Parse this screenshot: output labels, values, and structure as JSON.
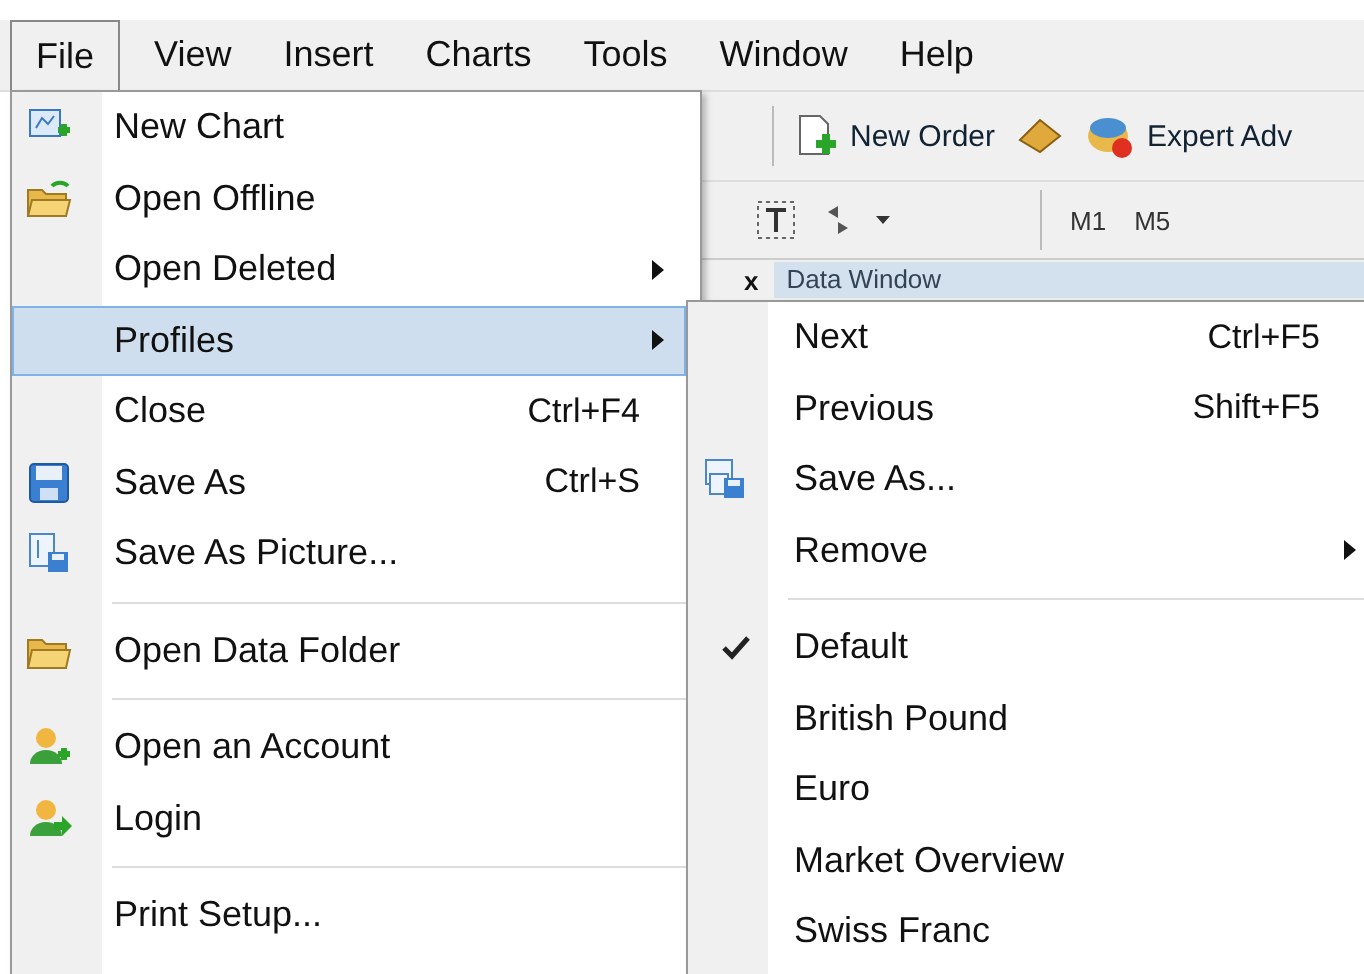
{
  "menubar": [
    {
      "label": "File",
      "selected": true
    },
    {
      "label": "View",
      "selected": false
    },
    {
      "label": "Insert",
      "selected": false
    },
    {
      "label": "Charts",
      "selected": false
    },
    {
      "label": "Tools",
      "selected": false
    },
    {
      "label": "Window",
      "selected": false
    },
    {
      "label": "Help",
      "selected": false
    }
  ],
  "toolbar": {
    "new_order": "New Order",
    "expert": "Expert Adv",
    "timeframes": [
      "M1",
      "M5"
    ],
    "close": "x",
    "panel_tab": "Data Window"
  },
  "file_menu": [
    {
      "kind": "item",
      "label": "New Chart",
      "selected": false,
      "submenu": false
    },
    {
      "kind": "item",
      "label": "Open Offline",
      "selected": false,
      "submenu": false
    },
    {
      "kind": "item",
      "label": "Open Deleted",
      "selected": false,
      "submenu": true
    },
    {
      "kind": "item",
      "label": "Profiles",
      "selected": true,
      "submenu": true
    },
    {
      "kind": "item",
      "label": "Close",
      "shortcut": "Ctrl+F4",
      "selected": false,
      "submenu": false
    },
    {
      "kind": "item",
      "label": "Save As",
      "shortcut": "Ctrl+S",
      "selected": false,
      "submenu": false
    },
    {
      "kind": "item",
      "label": "Save As Picture...",
      "selected": false,
      "submenu": false
    },
    {
      "kind": "separator"
    },
    {
      "kind": "item",
      "label": "Open Data Folder",
      "selected": false,
      "submenu": false
    },
    {
      "kind": "separator"
    },
    {
      "kind": "item",
      "label": "Open an Account",
      "selected": false,
      "submenu": false
    },
    {
      "kind": "item",
      "label": "Login",
      "selected": false,
      "submenu": false
    },
    {
      "kind": "separator"
    },
    {
      "kind": "item",
      "label": "Print Setup...",
      "selected": false,
      "submenu": false
    }
  ],
  "profiles_menu": [
    {
      "kind": "item",
      "label": "Next",
      "shortcut": "Ctrl+F5",
      "checked": false,
      "submenu": false
    },
    {
      "kind": "item",
      "label": "Previous",
      "shortcut": "Shift+F5",
      "checked": false,
      "submenu": false
    },
    {
      "kind": "item",
      "label": "Save As...",
      "checked": false,
      "submenu": false
    },
    {
      "kind": "item",
      "label": "Remove",
      "checked": false,
      "submenu": true
    },
    {
      "kind": "separator"
    },
    {
      "kind": "item",
      "label": "Default",
      "checked": true,
      "submenu": false
    },
    {
      "kind": "item",
      "label": "British Pound",
      "checked": false,
      "submenu": false
    },
    {
      "kind": "item",
      "label": "Euro",
      "checked": false,
      "submenu": false
    },
    {
      "kind": "item",
      "label": "Market Overview",
      "checked": false,
      "submenu": false
    },
    {
      "kind": "item",
      "label": "Swiss Franc",
      "checked": false,
      "submenu": false
    }
  ]
}
